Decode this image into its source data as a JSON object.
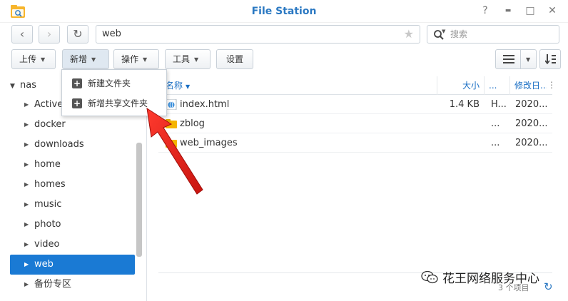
{
  "window": {
    "title": "File Station",
    "help": "?",
    "minimize": "▬",
    "maximize": "□",
    "close": "✕"
  },
  "nav": {
    "back": "‹",
    "forward": "›",
    "refresh": "↻",
    "path": "web",
    "star": "★",
    "search_placeholder": "搜索"
  },
  "toolbar": {
    "upload": "上传",
    "new": "新增",
    "action": "操作",
    "tools": "工具",
    "settings": "设置"
  },
  "new_menu": {
    "items": [
      "新建文件夹",
      "新增共享文件夹"
    ]
  },
  "sidebar": {
    "root": "nas",
    "items": [
      "Active",
      "docker",
      "downloads",
      "home",
      "homes",
      "music",
      "photo",
      "video",
      "web",
      "备份专区"
    ],
    "selected": "web"
  },
  "columns": {
    "name": "名称",
    "size": "大小",
    "type": "...",
    "modified": "修改日...",
    "menu": "⋮"
  },
  "files": [
    {
      "name": "index.html",
      "size": "1.4 KB",
      "type": "H...",
      "modified": "2020..."
    },
    {
      "name": "zblog",
      "size": "",
      "type": "...",
      "modified": "2020..."
    },
    {
      "name": "web_images",
      "size": "",
      "type": "...",
      "modified": "2020..."
    }
  ],
  "status": {
    "count": "3 个项目",
    "refresh": "↻"
  },
  "watermark": "花王网络服务中心",
  "colors": {
    "accent": "#1a7ad4",
    "title": "#2a78c2",
    "folder": "#f5b400",
    "arrow": "#e0201c"
  }
}
